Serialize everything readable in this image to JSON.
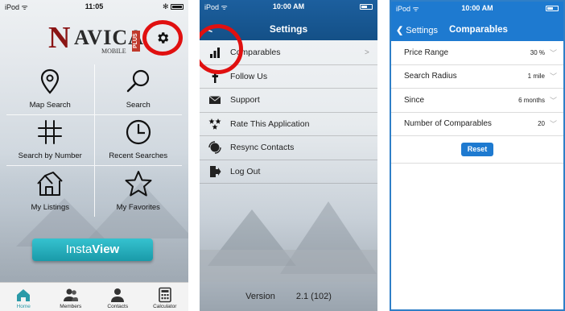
{
  "colors": {
    "brand_red": "#8a1515",
    "highlight_ring": "#e01010",
    "nav_blue": "#1e7ad0",
    "teal": "#2b9aa8"
  },
  "home": {
    "status": {
      "carrier": "iPod",
      "time": "11:05"
    },
    "logo": {
      "text_n": "N",
      "text_rest": "AVICA",
      "text_sub": "MOBILE",
      "text_plus": "PLUS"
    },
    "settings_icon": "gear-icon",
    "grid": [
      {
        "label": "Map Search",
        "icon": "map-pin-icon"
      },
      {
        "label": "Search",
        "icon": "magnifier-icon"
      },
      {
        "label": "Search by Number",
        "icon": "hash-icon"
      },
      {
        "label": "Recent Searches",
        "icon": "clock-icon"
      },
      {
        "label": "My Listings",
        "icon": "house-icon"
      },
      {
        "label": "My Favorites",
        "icon": "star-icon"
      }
    ],
    "instaview": {
      "prefix": "Insta",
      "bold": "View"
    },
    "tabs": [
      {
        "label": "Home",
        "icon": "home-icon",
        "active": true
      },
      {
        "label": "Members",
        "icon": "members-icon",
        "active": false
      },
      {
        "label": "Contacts",
        "icon": "contact-icon",
        "active": false
      },
      {
        "label": "Calculator",
        "icon": "calculator-icon",
        "active": false
      }
    ]
  },
  "settings": {
    "status": {
      "carrier": "iPod",
      "time": "10:00 AM"
    },
    "title": "Settings",
    "back": "<",
    "items": [
      {
        "label": "Comparables",
        "icon": "bar-chart-icon",
        "chevron": ">"
      },
      {
        "label": "Follow Us",
        "icon": "facebook-icon",
        "chevron": ""
      },
      {
        "label": "Support",
        "icon": "envelope-icon",
        "chevron": ""
      },
      {
        "label": "Rate This Application",
        "icon": "stars-icon",
        "chevron": ""
      },
      {
        "label": "Resync Contacts",
        "icon": "resync-icon",
        "chevron": ""
      },
      {
        "label": "Log Out",
        "icon": "logout-icon",
        "chevron": ""
      }
    ],
    "version_label": "Version",
    "version_value": "2.1 (102)"
  },
  "comparables": {
    "status": {
      "carrier": "iPod",
      "time": "10:00 AM"
    },
    "back_label": "Settings",
    "title": "Comparables",
    "rows": [
      {
        "label": "Price Range",
        "value": "30 %"
      },
      {
        "label": "Search Radius",
        "value": "1 mile"
      },
      {
        "label": "Since",
        "value": "6 months"
      },
      {
        "label": "Number of Comparables",
        "value": "20"
      }
    ],
    "reset_label": "Reset"
  }
}
